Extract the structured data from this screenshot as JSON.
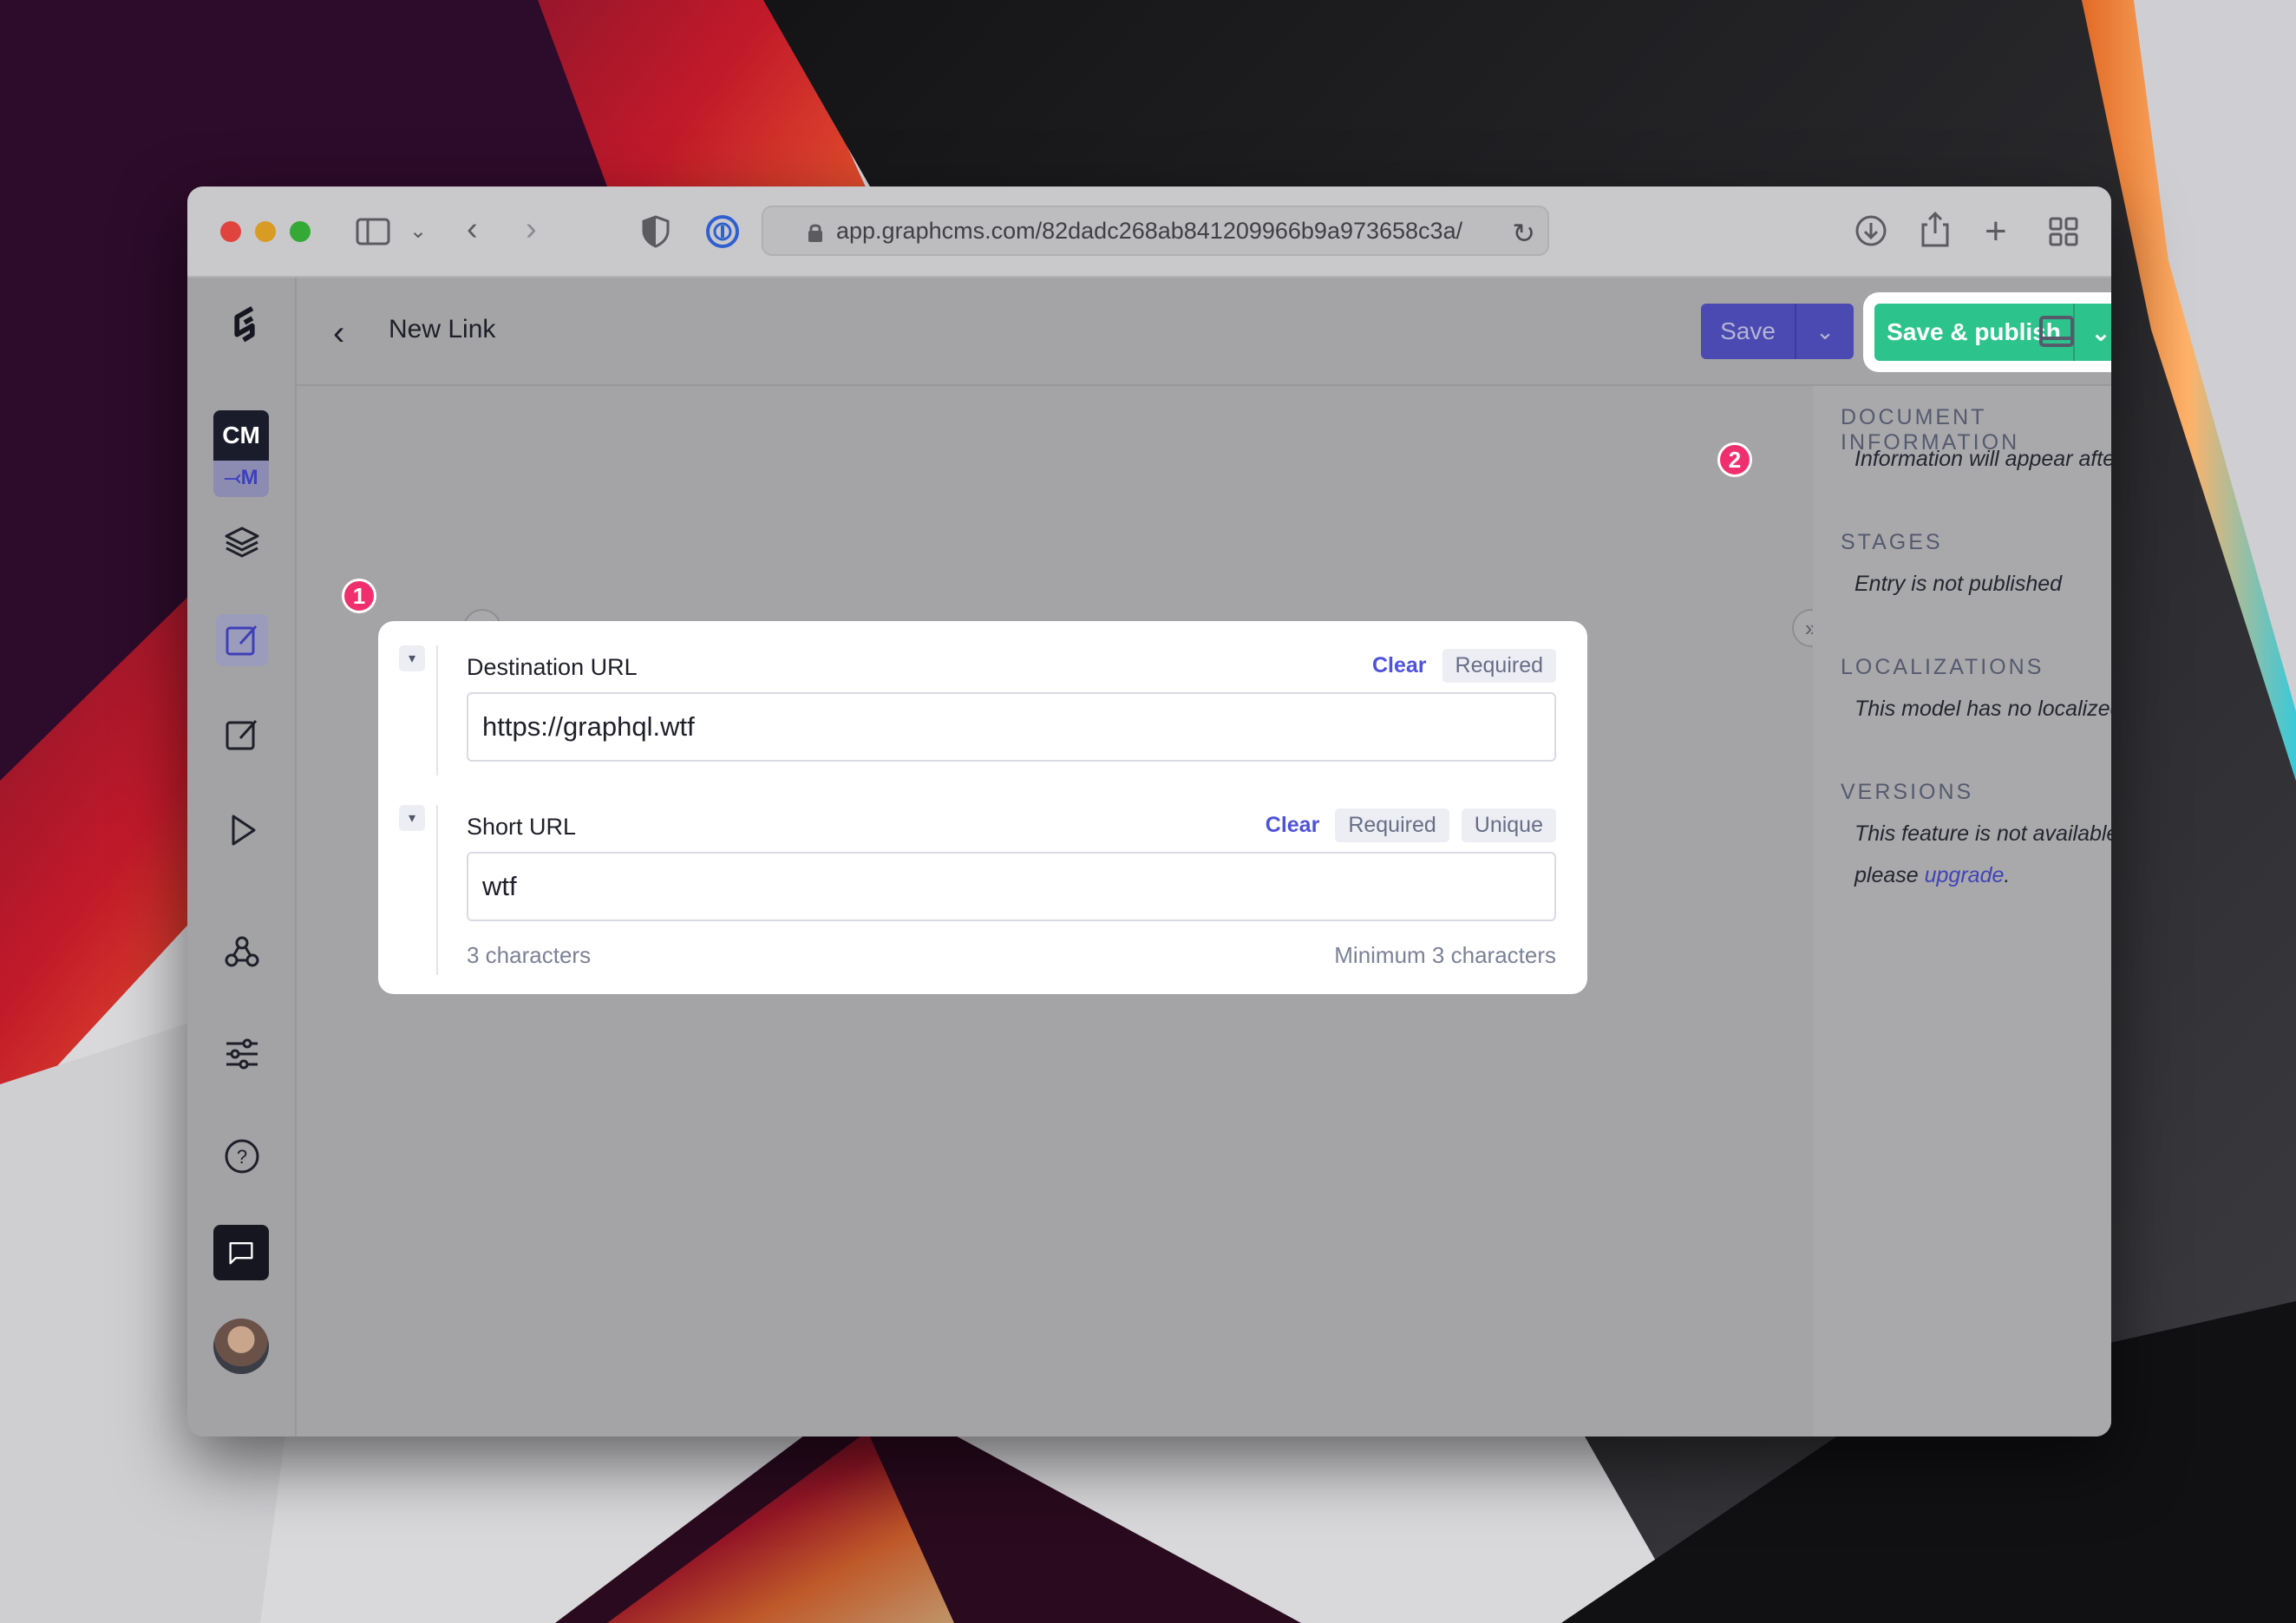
{
  "browser": {
    "url": "app.graphcms.com/82dadc268ab841209966b9a973658c3a/",
    "colors": {
      "close": "#e0443e",
      "minimize": "#d89c25",
      "maximize": "#35a935"
    }
  },
  "sidebar": {
    "project_badge": "CM",
    "environment_label": "M",
    "items": [
      {
        "icon": "layers-icon"
      },
      {
        "icon": "content-edit-icon"
      },
      {
        "icon": "edit-icon"
      },
      {
        "icon": "play-icon"
      },
      {
        "icon": "webhooks-icon"
      },
      {
        "icon": "settings-sliders-icon"
      },
      {
        "icon": "help-icon"
      },
      {
        "icon": "chat-icon"
      },
      {
        "icon": "avatar"
      }
    ]
  },
  "header": {
    "title": "New Link",
    "save_label": "Save",
    "publish_label": "Save & publish"
  },
  "steps": {
    "one": "1",
    "two": "2"
  },
  "form": {
    "fields": [
      {
        "label": "Destination URL",
        "clear": "Clear",
        "tags": [
          "Required"
        ],
        "value": "https://graphql.wtf"
      },
      {
        "label": "Short URL",
        "clear": "Clear",
        "tags": [
          "Required",
          "Unique"
        ],
        "value": "wtf",
        "count_hint": "3 characters",
        "min_hint": "Minimum 3 characters"
      }
    ]
  },
  "info_panel": {
    "document_heading": "DOCUMENT INFORMATION",
    "document_text": "Information will appear after saving",
    "stages_heading": "STAGES",
    "stages_text": "Entry is not published",
    "localizations_heading": "LOCALIZATIONS",
    "localizations_text": "This model has no localized fields",
    "versions_heading": "VERSIONS",
    "versions_text": "This feature is not available on your plan, please ",
    "versions_link": "upgrade",
    "versions_end": "."
  }
}
